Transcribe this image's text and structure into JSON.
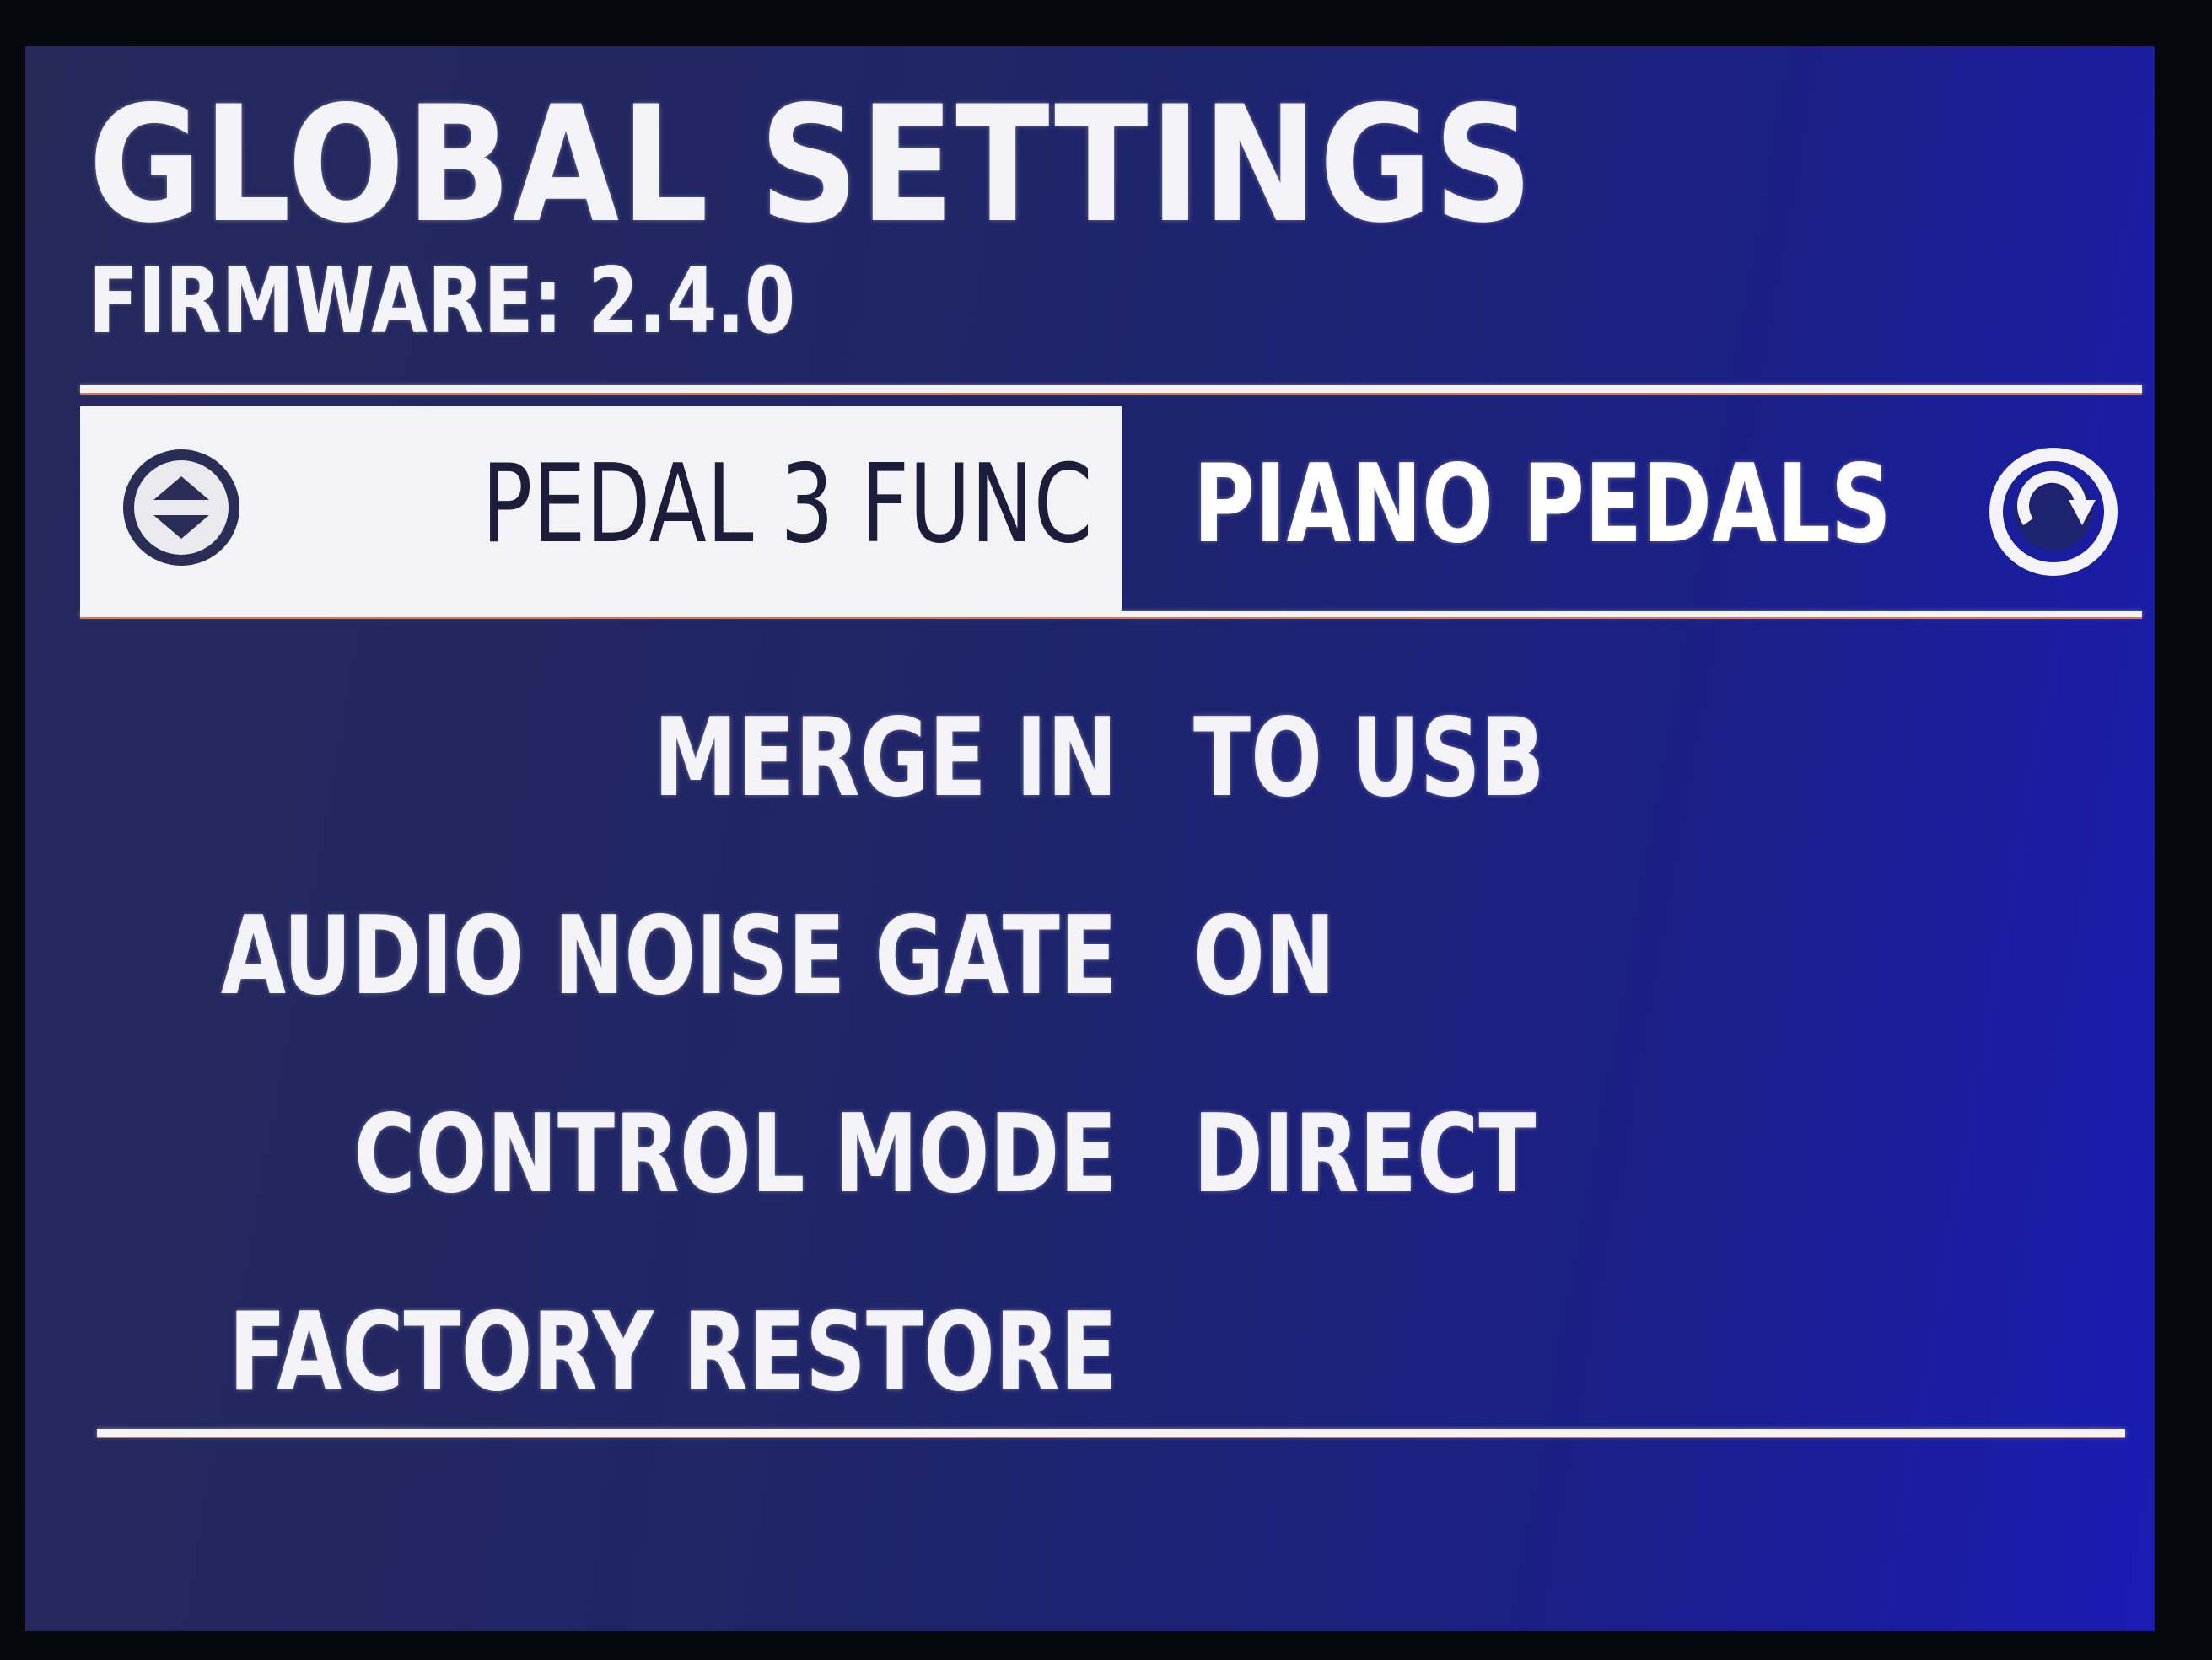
{
  "header": {
    "title": "GLOBAL SETTINGS",
    "firmware": "FIRMWARE: 2.4.0"
  },
  "settings": [
    {
      "label": "PEDAL 3 FUNC",
      "value": "PIANO PEDALS",
      "selected": true
    },
    {
      "label": "MERGE IN",
      "value": "TO USB",
      "selected": false
    },
    {
      "label": "AUDIO NOISE GATE",
      "value": "ON",
      "selected": false
    },
    {
      "label": "CONTROL MODE",
      "value": "DIRECT",
      "selected": false
    },
    {
      "label": "FACTORY RESTORE",
      "value": "",
      "selected": false
    }
  ],
  "icons": {
    "scroll": "up-down-arrows-icon",
    "encoder": "rotate-knob-icon"
  },
  "colors": {
    "background": "#1f2568",
    "highlight": "#f3f3f6",
    "text": "#f4f4f8"
  }
}
